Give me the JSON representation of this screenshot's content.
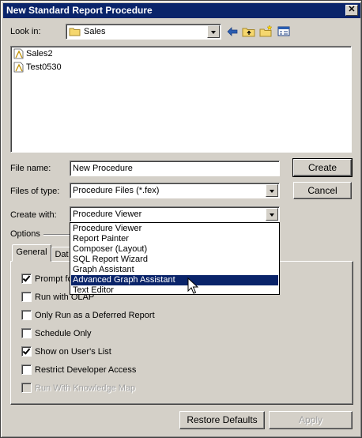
{
  "window": {
    "title": "New Standard Report Procedure",
    "close_glyph": "✕"
  },
  "lookin": {
    "label": "Look in:",
    "value": "Sales"
  },
  "files": [
    {
      "name": "Sales2",
      "icon": "report-file-icon"
    },
    {
      "name": "Test0530",
      "icon": "report-file-icon"
    }
  ],
  "form": {
    "filename_label": "File name:",
    "filename_value": "New Procedure",
    "filetype_label": "Files of type:",
    "filetype_value": "Procedure Files (*.fex)",
    "createwith_label": "Create with:",
    "createwith_value": "Procedure Viewer"
  },
  "buttons": {
    "create": "Create",
    "cancel": "Cancel",
    "restore": "Restore Defaults",
    "apply": "Apply"
  },
  "createwith_options": [
    {
      "label": "Procedure Viewer",
      "selected": false
    },
    {
      "label": "Report Painter",
      "selected": false
    },
    {
      "label": "Composer (Layout)",
      "selected": false
    },
    {
      "label": "SQL Report Wizard",
      "selected": false
    },
    {
      "label": "Graph Assistant",
      "selected": false
    },
    {
      "label": "Advanced Graph Assistant",
      "selected": true
    },
    {
      "label": "Text Editor",
      "selected": false
    }
  ],
  "options": {
    "label": "Options",
    "tabs": [
      {
        "label": "General",
        "active": true
      },
      {
        "label": "Dat",
        "active": false
      }
    ],
    "checkboxes": [
      {
        "label": "Prompt fo",
        "checked": true,
        "disabled": false
      },
      {
        "label": "Run with OLAP",
        "checked": false,
        "disabled": false
      },
      {
        "label": "Only Run as a Deferred Report",
        "checked": false,
        "disabled": false
      },
      {
        "label": "Schedule Only",
        "checked": false,
        "disabled": false
      },
      {
        "label": "Show on User's List",
        "checked": true,
        "disabled": false
      },
      {
        "label": "Restrict Developer Access",
        "checked": false,
        "disabled": false
      },
      {
        "label": "Run With Knowledge Map",
        "checked": false,
        "disabled": true
      }
    ]
  },
  "colors": {
    "titlebar": "#0a246a",
    "face": "#d4d0c8",
    "highlight": "#0a246a"
  }
}
